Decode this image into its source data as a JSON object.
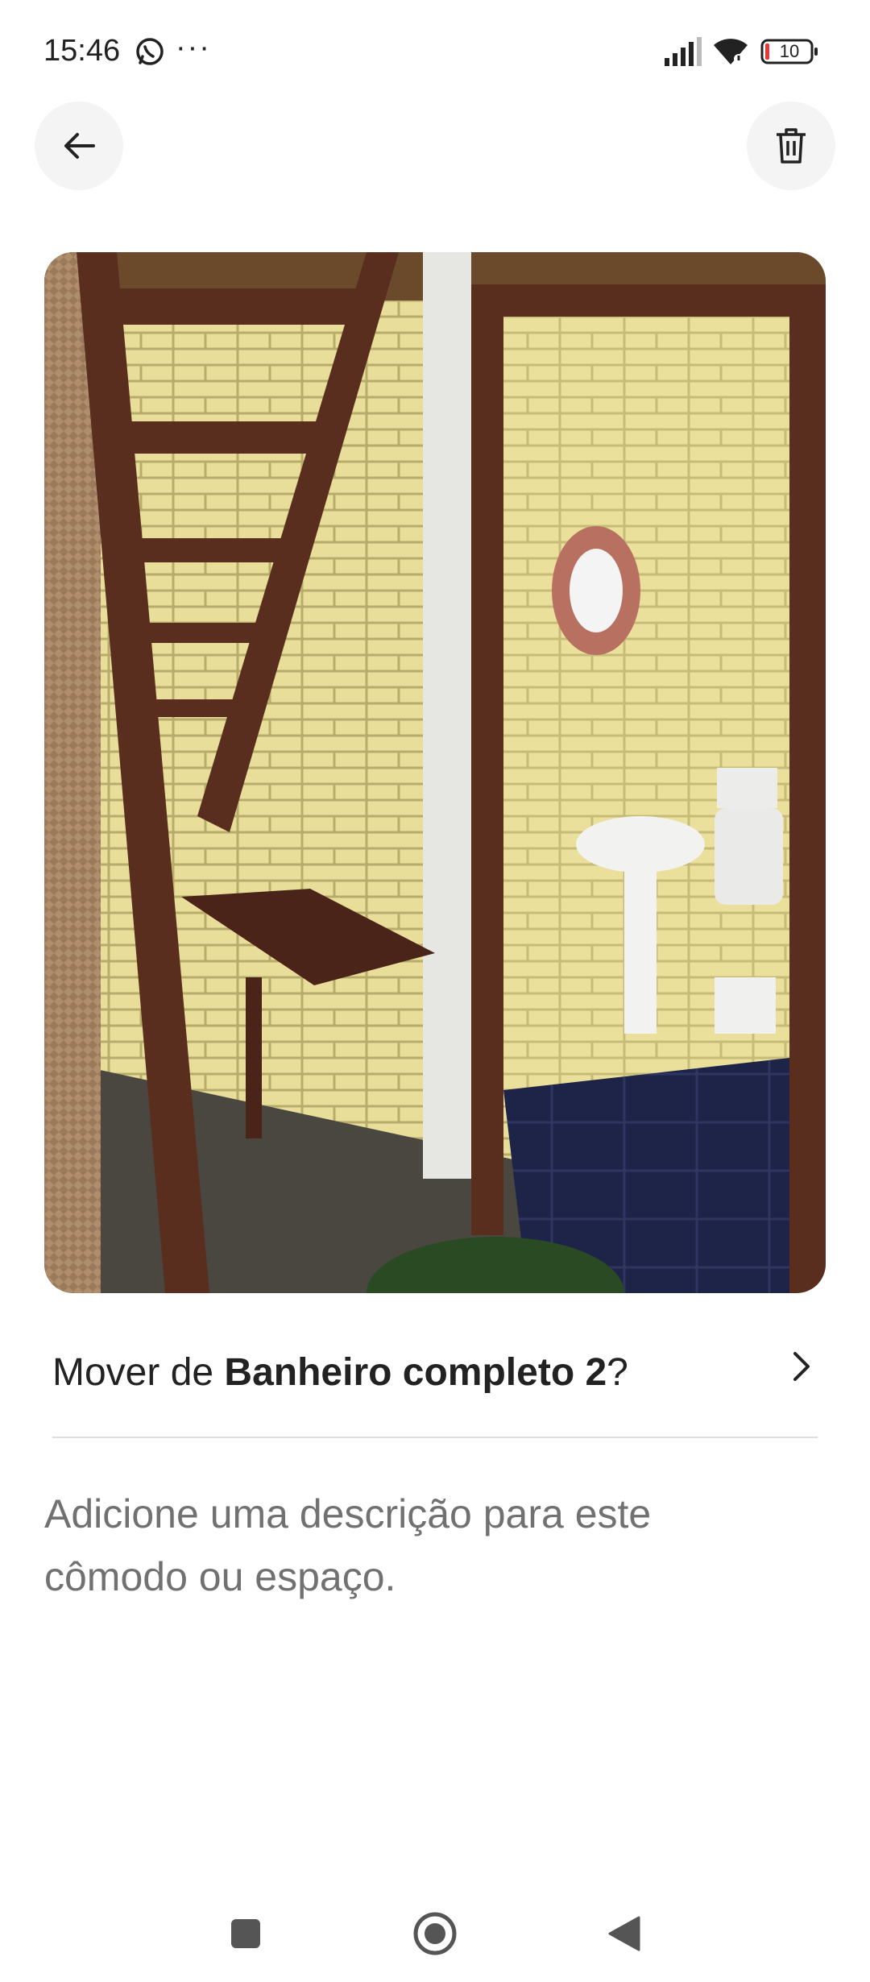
{
  "status_bar": {
    "time": "15:46",
    "more": "···",
    "battery_level": "10",
    "icons": [
      "whatsapp-icon",
      "signal-icon",
      "wifi-icon",
      "battery-icon"
    ]
  },
  "header": {
    "back_icon": "arrow-left-icon",
    "delete_icon": "trash-icon"
  },
  "photo": {
    "subject": "bathroom-photo"
  },
  "move": {
    "prefix": "Mover de ",
    "room": "Banheiro completo 2",
    "suffix": "?",
    "icon": "chevron-right-icon"
  },
  "description": {
    "placeholder": "Adicione uma descrição para este cômodo ou espaço."
  },
  "nav": {
    "icons": [
      "recents-square-icon",
      "home-circle-icon",
      "back-triangle-icon"
    ]
  },
  "colors": {
    "text": "#222222",
    "placeholder": "#717171",
    "button_bg": "#f4f4f4",
    "divider": "#dddddd",
    "battery_low": "#e53935"
  }
}
